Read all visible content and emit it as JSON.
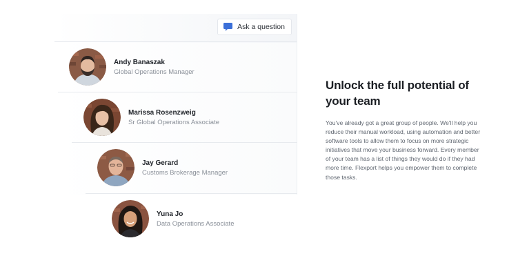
{
  "ask_button": {
    "label": "Ask a question",
    "icon": "chat-bubble-icon",
    "icon_color": "#3b6fd8"
  },
  "team": [
    {
      "name": "Andy Banaszak",
      "role": "Global Operations Manager"
    },
    {
      "name": "Marissa Rosenzweig",
      "role": "Sr Global Operations Associate"
    },
    {
      "name": "Jay Gerard",
      "role": "Customs Brokerage Manager"
    },
    {
      "name": "Yuna Jo",
      "role": "Data Operations Associate"
    }
  ],
  "section": {
    "title": "Unlock the full potential of your team",
    "body": "You've already got a great group of people. We'll help you reduce their manual workload, using automation and better software tools to allow them to focus on more strategic initiatives that move your business forward. Every member of your team has a list of things they would do if they had more time. Flexport helps you empower them to complete those tasks."
  }
}
